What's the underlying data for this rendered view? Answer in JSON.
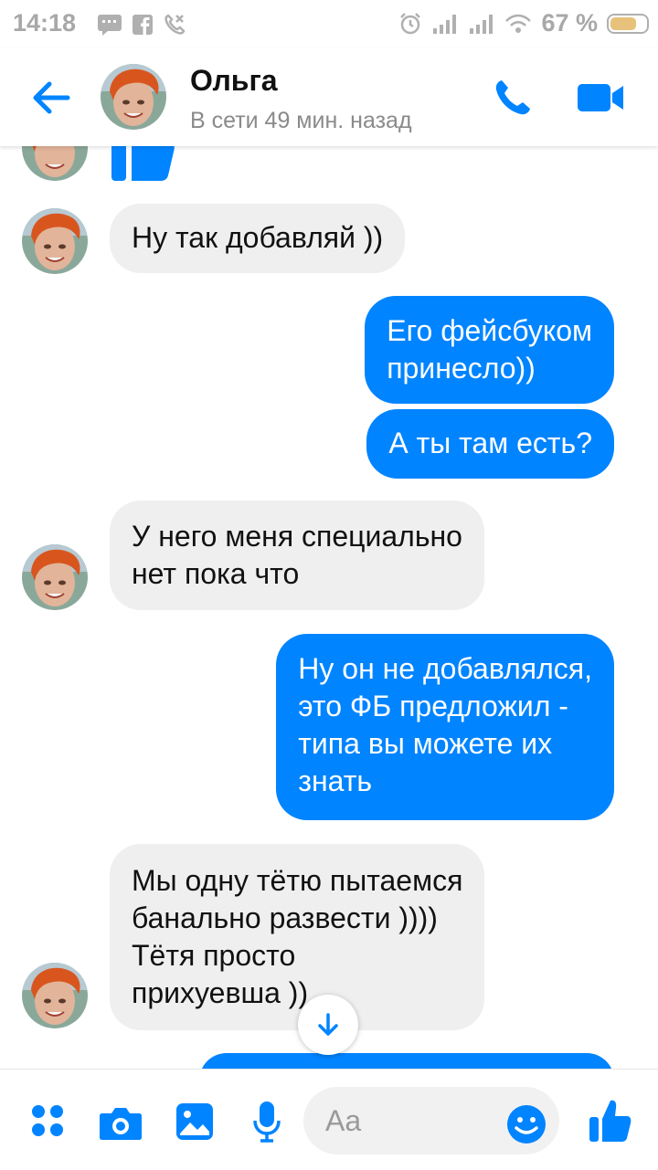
{
  "status_bar": {
    "time": "14:18",
    "battery": "67 %"
  },
  "header": {
    "contact_name": "Ольга",
    "contact_status": "В сети 49 мин. назад"
  },
  "messages": [
    {
      "from": "them",
      "text": "Ну так добавляй ))"
    },
    {
      "from": "me",
      "text": "Его фейсбуком\nпринесло))"
    },
    {
      "from": "me",
      "text": "А ты там есть?"
    },
    {
      "from": "them",
      "text": "У него меня специально\nнет пока что"
    },
    {
      "from": "me",
      "text": "Ну он не добавлялся,\nэто ФБ предложил -\nтипа вы можете их\nзнать"
    },
    {
      "from": "them",
      "text": "Мы одну тётю пытаемся\nбанально развести ))))\nТётя просто\nприхуевша ))"
    }
  ],
  "composer": {
    "placeholder": "Aa"
  },
  "colors": {
    "accent": "#0084ff",
    "incoming_bubble": "#efefef",
    "status_text": "#a8a8a8"
  },
  "icons": [
    "back-arrow-icon",
    "phone-icon",
    "video-camera-icon",
    "thumbs-up-icon",
    "apps-grid-icon",
    "camera-icon",
    "gallery-icon",
    "microphone-icon",
    "emoji-icon",
    "arrow-down-icon",
    "chat-bubble-icon",
    "facebook-icon",
    "missed-call-icon",
    "alarm-icon",
    "signal-icon",
    "wifi-icon",
    "battery-icon"
  ]
}
